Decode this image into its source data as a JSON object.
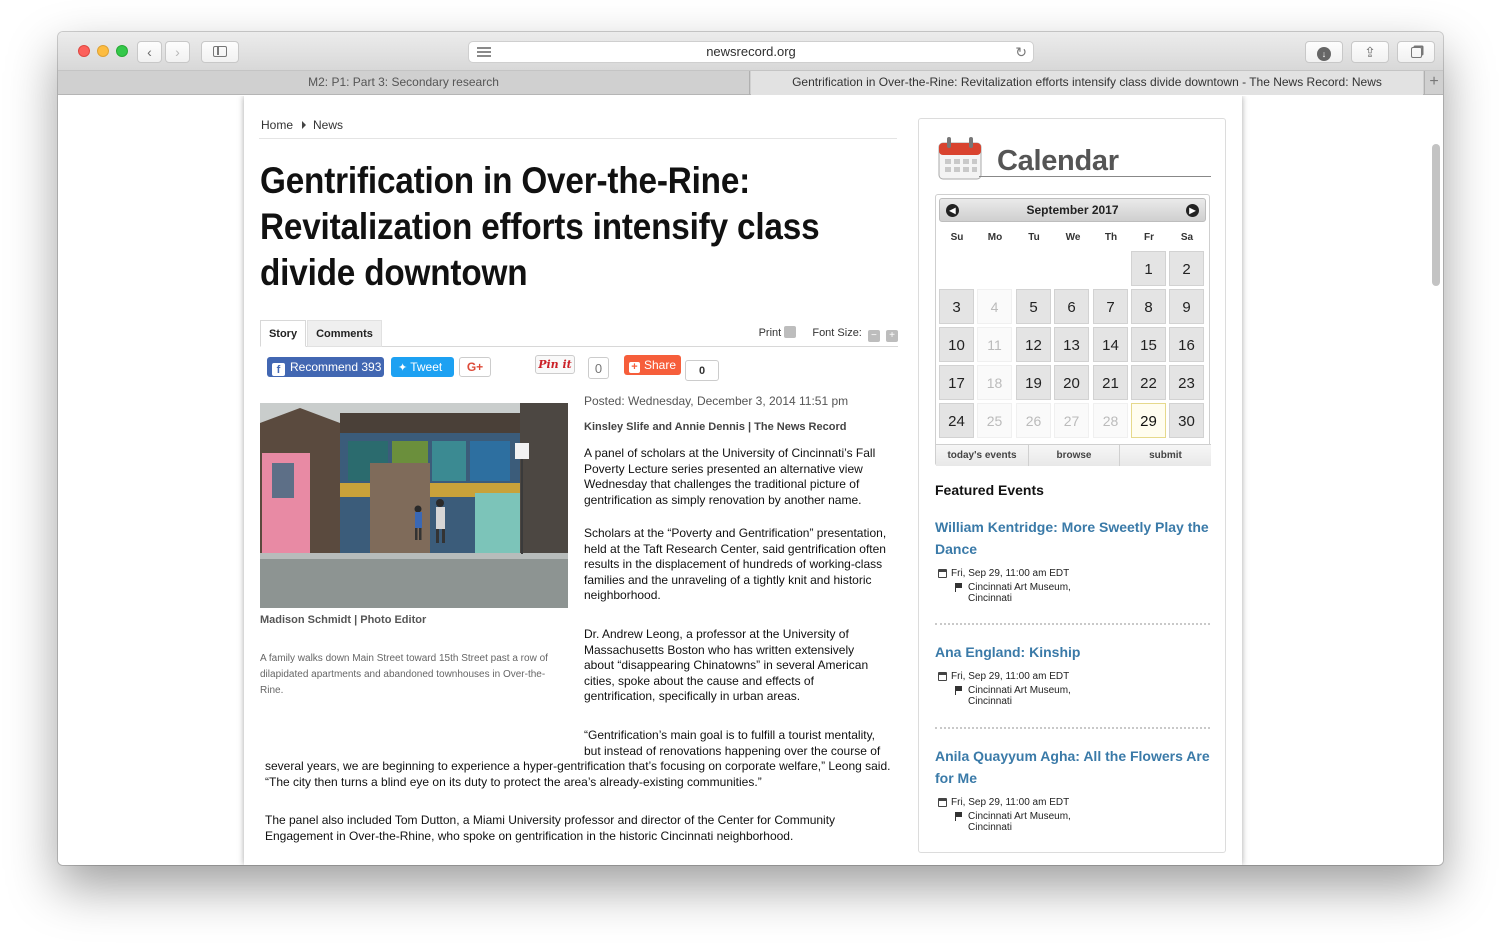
{
  "browser": {
    "url": "newsrecord.org",
    "tabs": [
      {
        "label": "M2: P1: Part 3: Secondary research"
      },
      {
        "label": "Gentrification in Over-the-Rine: Revitalization efforts intensify class divide downtown - The News Record: News"
      }
    ],
    "icons": {
      "back": "chevron-left-icon",
      "forward": "chevron-right-icon",
      "sidebar": "sidebar-icon",
      "reader": "reader-icon",
      "reload": "reload-icon",
      "download": "download-icon",
      "share": "share-icon",
      "tabs": "tabs-icon",
      "new_tab": "plus-icon"
    }
  },
  "breadcrumb": {
    "home": "Home",
    "section": "News"
  },
  "article": {
    "headline": "Gentrification in Over-the-Rine: Revitalization efforts intensify class divide downtown",
    "tabs": {
      "story": "Story",
      "comments": "Comments"
    },
    "tools": {
      "print": "Print",
      "font_size": "Font Size:"
    },
    "share": {
      "recommend": "Recommend 393",
      "tweet": "Tweet",
      "gplus": "G+",
      "pin": "Pin it",
      "pin_count": "0",
      "share": "Share",
      "share_count": "0"
    },
    "photo_credit": "Madison Schmidt | Photo Editor",
    "photo_caption": "A family walks down Main Street toward 15th Street past a row of dilapidated apartments and abandoned townhouses in Over-the-Rine.",
    "posted": "Posted: Wednesday, December 3, 2014 11:51 pm",
    "byline": "Kinsley Slife and Annie Dennis | The News Record",
    "paragraphs": {
      "p1": "A panel of scholars at the University of Cincinnati’s Fall Poverty Lecture series presented an alternative view Wednesday that challenges the traditional picture of gentrification as simply renovation by another name.",
      "p2": "Scholars at the “Poverty and Gentrification” presentation, held at the Taft Research Center, said gentrification often results in the displacement of hundreds of working-class families and the unraveling of a tightly knit and historic neighborhood.",
      "p3": "Dr. Andrew Leong, a professor at the University of Massachusetts Boston who has written extensively about “disappearing Chinatowns” in several American cities, spoke about the cause and effects of gentrification, specifically in urban areas.",
      "p4_lead": "“Gentrification’s main goal is to fulfill a tourist mentality, but instead of renovations happening over the course of",
      "p4_rest": "several years, we are beginning to experience a hyper-gentrification that’s focusing on corporate welfare,” Leong said. “The city then turns a blind eye on its duty to protect the area’s already-existing communities.”",
      "p5": "The panel also included Tom Dutton, a Miami University professor and director of the Center for Community Engagement in Over-the-Rhine, who spoke on gentrification in the historic Cincinnati neighborhood."
    }
  },
  "calendar": {
    "title": "Calendar",
    "month": "September 2017",
    "weekdays": [
      "Su",
      "Mo",
      "Tu",
      "We",
      "Th",
      "Fr",
      "Sa"
    ],
    "days": [
      "1",
      "2",
      "3",
      "4",
      "5",
      "6",
      "7",
      "8",
      "9",
      "10",
      "11",
      "12",
      "13",
      "14",
      "15",
      "16",
      "17",
      "18",
      "19",
      "20",
      "21",
      "22",
      "23",
      "24",
      "25",
      "26",
      "27",
      "28",
      "29",
      "30"
    ],
    "today": "29",
    "footer": {
      "today": "today's events",
      "browse": "browse",
      "submit": "submit"
    }
  },
  "featured": {
    "title": "Featured Events",
    "events": [
      {
        "title": "William Kentridge: More Sweetly Play the Dance",
        "time": "Fri, Sep 29, 11:00 am EDT",
        "venue": "Cincinnati Art Museum,",
        "city": "Cincinnati"
      },
      {
        "title": "Ana England: Kinship",
        "time": "Fri, Sep 29, 11:00 am EDT",
        "venue": "Cincinnati Art Museum,",
        "city": "Cincinnati"
      },
      {
        "title": "Anila Quayyum Agha: All the Flowers Are for Me",
        "time": "Fri, Sep 29, 11:00 am EDT",
        "venue": "Cincinnati Art Museum,",
        "city": "Cincinnati"
      }
    ]
  }
}
